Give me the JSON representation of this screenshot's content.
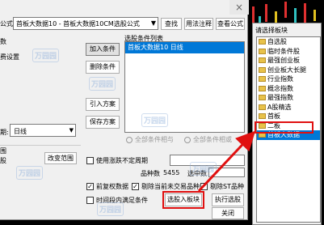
{
  "dialog": {
    "formula_label": "公式",
    "formula_value": "首板大数据10 - 首板大数据10CM选股公式",
    "buttons": {
      "find": "查找",
      "usage": "用法注释",
      "view_formula": "查看公式",
      "add_condition": "加入条件",
      "delete_condition": "删除条件",
      "import_plan": "引入方案",
      "save_plan": "保存方案",
      "change_range": "改变范围",
      "select_to_block": "选股入板块",
      "execute": "执行选股",
      "close": "关闭"
    },
    "left_labels": {
      "params": "数",
      "settings": "费设置",
      "period_prefix": "周",
      "period_label": "期:",
      "range_label": "股",
      "range_group": "围"
    },
    "period_value": "日线",
    "conditions_header": "选股条件列表",
    "condition_item": "首板大数据10  日线",
    "radio_and": "全部条件相与",
    "radio_or": "全部条件相或",
    "use_adjusted_label": "使用涨跌不定周期",
    "stock_count_label": "品种数",
    "stock_count_value": "5455",
    "selected_label": "选中数",
    "selected_value": "",
    "chk_pre_adjust": "前复权数据",
    "chk_exclude_untraded": "剔除当前未交易品种",
    "chk_exclude_st": "剔除ST品种",
    "chk_time_condition": "时间段内满足条件",
    "watermarks": [
      "万园园",
      "万园园",
      "万园园",
      "万园园",
      "万园园",
      "万园园"
    ]
  },
  "picker": {
    "title": "请选择板块",
    "items": [
      {
        "label": "自选股",
        "selected": false
      },
      {
        "label": "临时条件股",
        "selected": false
      },
      {
        "label": "最强创业板",
        "selected": false
      },
      {
        "label": "创业板大长腿",
        "selected": false
      },
      {
        "label": "行业指数",
        "selected": false
      },
      {
        "label": "概念指数",
        "selected": false
      },
      {
        "label": "最强指数",
        "selected": false
      },
      {
        "label": "A股精选",
        "selected": false
      },
      {
        "label": "首板",
        "selected": false
      },
      {
        "label": "二板",
        "selected": false
      },
      {
        "label": "首板大数据",
        "selected": true
      }
    ]
  },
  "colors": {
    "highlight": "#e01010",
    "selection": "#0078d7"
  }
}
